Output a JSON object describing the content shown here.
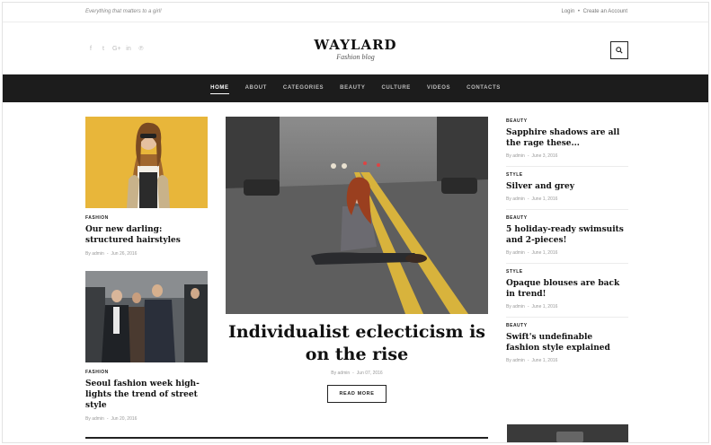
{
  "topbar": {
    "tagline": "Everything that matters to a girl!",
    "login": "Login",
    "separator": "•",
    "create_account": "Create an Account"
  },
  "header": {
    "logo_title": "WAYLARD",
    "logo_subtitle": "Fashion blog",
    "social_icons": [
      "facebook-icon",
      "twitter-icon",
      "google-plus-icon",
      "linkedin-icon",
      "pinterest-icon"
    ]
  },
  "nav": {
    "items": [
      "HOME",
      "ABOUT",
      "CATEGORIES",
      "BEAUTY",
      "CULTURE",
      "VIDEOS",
      "CONTACTS"
    ],
    "active": "HOME"
  },
  "left_posts": [
    {
      "category": "FASHION",
      "title": "Our new darling: structured hairstyles",
      "author": "By admin",
      "date": "Jun 26, 2016"
    },
    {
      "category": "FASHION",
      "title": "Seoul fashion week high-lights the trend of street style",
      "author": "By admin",
      "date": "Jun 20, 2016"
    }
  ],
  "feature": {
    "title": "Individualist eclecticism is on the rise",
    "author": "By admin",
    "date": "Jun 07, 2016",
    "read_more": "READ MORE"
  },
  "side_posts": [
    {
      "category": "BEAUTY",
      "title": "Sapphire shadows are all the rage these...",
      "author": "By admin",
      "date": "June 3, 2016"
    },
    {
      "category": "STYLE",
      "title": "Silver and grey",
      "author": "By admin",
      "date": "June 1, 2016"
    },
    {
      "category": "BEAUTY",
      "title": "5 holiday-ready swimsuits and 2-pieces!",
      "author": "By admin",
      "date": "June 1, 2016"
    },
    {
      "category": "STYLE",
      "title": "Opaque blouses are back in trend!",
      "author": "By admin",
      "date": "June 1, 2016"
    },
    {
      "category": "BEAUTY",
      "title": "Swift's undefinable fashion style explained",
      "author": "By admin",
      "date": "June 1, 2016"
    }
  ],
  "colors": {
    "nav_bg": "#1c1c1c",
    "accent_yellow": "#e8b63a"
  }
}
